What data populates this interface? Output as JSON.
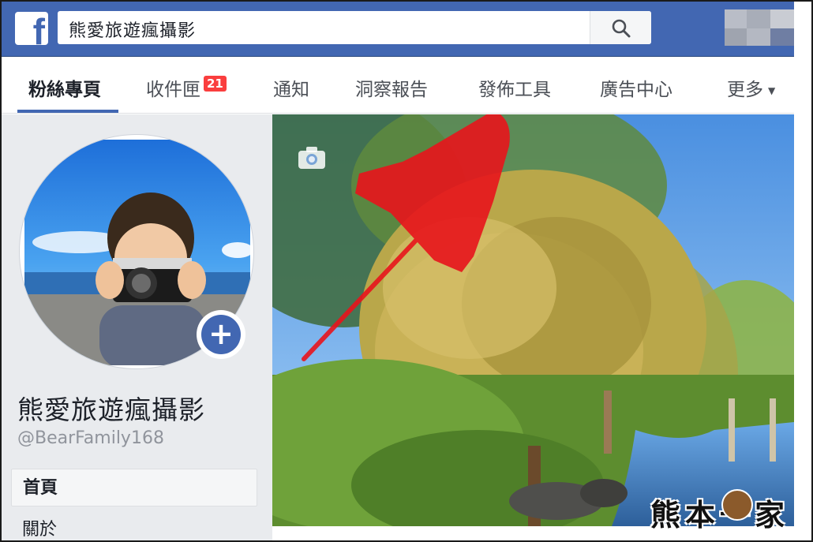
{
  "search": {
    "value": "熊愛旅遊瘋攝影"
  },
  "tabs": [
    {
      "label": "粉絲專頁"
    },
    {
      "label": "收件匣"
    },
    {
      "label": "通知"
    },
    {
      "label": "洞察報告"
    },
    {
      "label": "發佈工具"
    },
    {
      "label": "廣告中心"
    },
    {
      "label": "更多"
    }
  ],
  "inbox_badge": "21",
  "page": {
    "name": "熊愛旅遊瘋攝影",
    "handle": "@BearFamily168"
  },
  "left_nav": [
    {
      "label": "首頁"
    },
    {
      "label": "關於"
    }
  ],
  "watermark": "熊本一家",
  "colors": {
    "brand": "#4267b2",
    "badge": "#fa3e3e",
    "arrow": "#e8141c"
  },
  "icons": [
    "facebook-logo-icon",
    "search-icon",
    "camera-icon",
    "plus-icon",
    "dropdown-caret-icon"
  ]
}
